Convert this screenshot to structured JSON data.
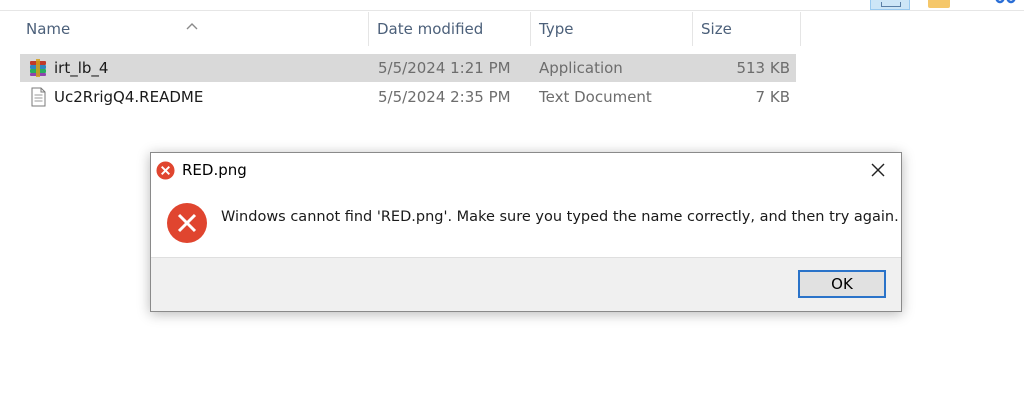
{
  "explorer": {
    "columns": {
      "name": "Name",
      "date_modified": "Date modified",
      "type": "Type",
      "size": "Size"
    },
    "files": [
      {
        "name": "irt_lb_4",
        "date_modified": "5/5/2024 1:21 PM",
        "type": "Application",
        "size": "513 KB",
        "icon": "winrar-app-icon",
        "selected": true
      },
      {
        "name": "Uc2RrigQ4.README",
        "date_modified": "5/5/2024 2:35 PM",
        "type": "Text Document",
        "size": "7 KB",
        "icon": "text-document-icon",
        "selected": false
      }
    ]
  },
  "dialog": {
    "title": "RED.png",
    "message": "Windows cannot find 'RED.png'. Make sure you typed the name correctly, and then try again.",
    "ok_label": "OK",
    "close_glyph": "✕",
    "icon": "error-icon"
  },
  "colors": {
    "error_red": "#e0452f",
    "selection_bg": "#d9d9d9",
    "header_text": "#4c607a",
    "button_focus": "#2a73c9"
  }
}
